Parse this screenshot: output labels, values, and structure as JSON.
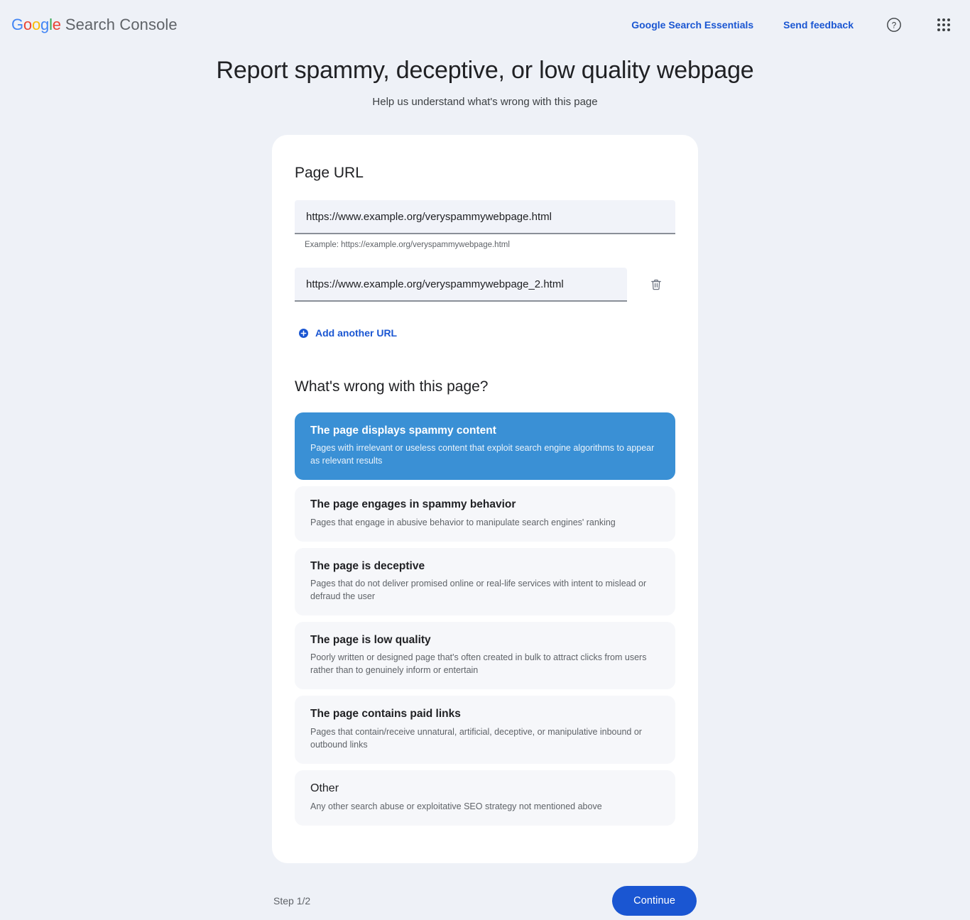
{
  "header": {
    "brand_google": "Google",
    "brand_product": "Search Console",
    "links": [
      {
        "label": "Google Search Essentials"
      },
      {
        "label": "Send feedback"
      }
    ],
    "help_icon": "help-circle-icon",
    "apps_icon": "apps-grid-icon"
  },
  "page": {
    "title": "Report spammy, deceptive, or low quality webpage",
    "subtitle": "Help us understand what's wrong with this page"
  },
  "url_section": {
    "title": "Page URL",
    "fields": [
      {
        "value": "https://www.example.org/veryspammywebpage.html",
        "placeholder": "https://example.org/veryspammywebpage.html",
        "hint": "Example: https://example.org/veryspammywebpage.html",
        "has_delete": false
      },
      {
        "value": "https://www.example.org/veryspammywebpage_2.html",
        "placeholder": "https://example.org/veryspammywebpage.html",
        "hint": "",
        "has_delete": true,
        "delete_icon": "trash-icon"
      }
    ],
    "add_another_label": "Add another URL",
    "add_another_icon": "plus-circle-icon"
  },
  "issue_section": {
    "title": "What's wrong with this page?",
    "selected_index": 0,
    "options": [
      {
        "title": "The page displays spammy content",
        "description": "Pages with irrelevant or useless content that exploit search engine algorithms to appear as relevant results"
      },
      {
        "title": "The page engages in spammy behavior",
        "description": "Pages that engage in abusive behavior to manipulate search engines' ranking"
      },
      {
        "title": "The page is deceptive",
        "description": "Pages that do not deliver promised online or real-life services with intent to mislead or defraud the user"
      },
      {
        "title": "The page is low quality",
        "description": "Poorly written or designed page that's often created in bulk to attract clicks from users rather than to genuinely inform or entertain"
      },
      {
        "title": "The page contains paid links",
        "description": "Pages that contain/receive unnatural, artificial, deceptive, or manipulative inbound or outbound links"
      },
      {
        "title": "Other",
        "description": "Any other search abuse or exploitative SEO strategy not mentioned above"
      }
    ]
  },
  "footer": {
    "step_label": "Step 1/2",
    "continue_label": "Continue"
  },
  "colors": {
    "page_background": "#eef1f7",
    "card_background": "#ffffff",
    "selected_option": "#3a90d5",
    "option_background": "#f6f7fa",
    "accent_blue": "#1a56d2",
    "input_fill": "#f1f3f9"
  }
}
